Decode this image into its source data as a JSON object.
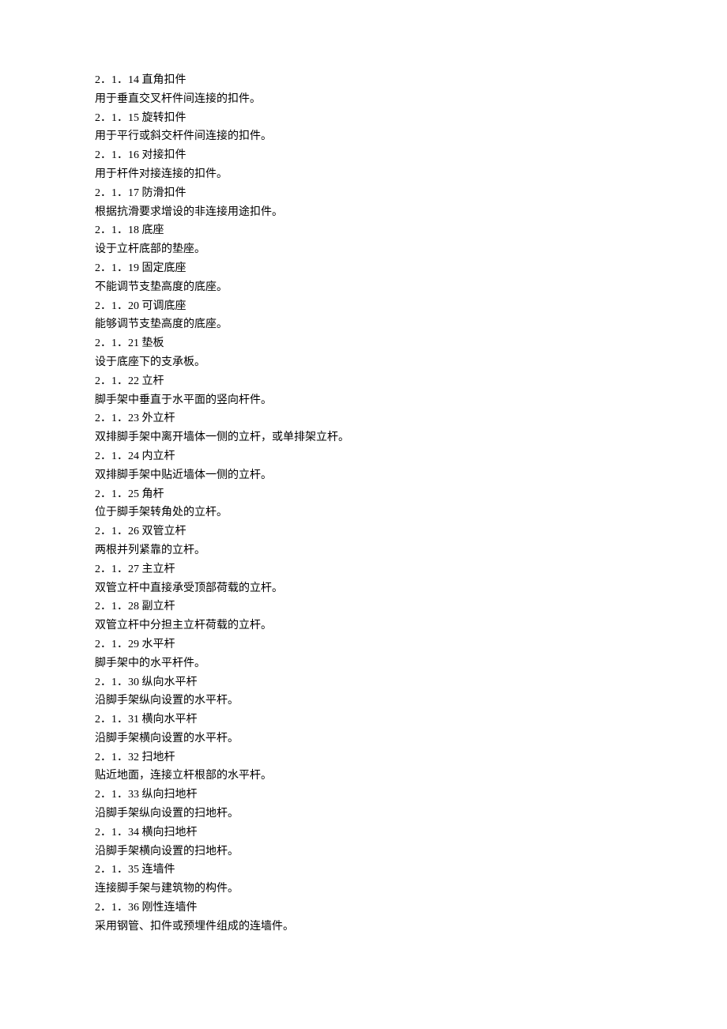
{
  "entries": [
    {
      "num": "2．1．14",
      "term": "直角扣件",
      "def": "用于垂直交叉杆件间连接的扣件。"
    },
    {
      "num": "2．1．15",
      "term": "旋转扣件",
      "def": "用于平行或斜交杆件间连接的扣件。"
    },
    {
      "num": "2．1．16",
      "term": "对接扣件",
      "def": "用于杆件对接连接的扣件。"
    },
    {
      "num": "2．1．17",
      "term": "防滑扣件",
      "def": "根据抗滑要求增设的非连接用途扣件。"
    },
    {
      "num": "2．1．18",
      "term": "底座",
      "def": "设于立杆底部的垫座。"
    },
    {
      "num": "2．1．19",
      "term": "固定底座",
      "def": "不能调节支垫高度的底座。"
    },
    {
      "num": "2．1．20",
      "term": "可调底座",
      "def": "能够调节支垫高度的底座。"
    },
    {
      "num": "2．1．21",
      "term": "垫板",
      "def": "设于底座下的支承板。"
    },
    {
      "num": "2．1．22",
      "term": "立杆",
      "def": "脚手架中垂直于水平面的竖向杆件。"
    },
    {
      "num": "2．1．23",
      "term": "外立杆",
      "def": "双排脚手架中离开墙体一侧的立杆，或单排架立杆。"
    },
    {
      "num": "2．1．24",
      "term": "内立杆",
      "def": "双排脚手架中贴近墙体一侧的立杆。"
    },
    {
      "num": "2．1．25",
      "term": "角杆",
      "def": "位于脚手架转角处的立杆。"
    },
    {
      "num": "2．1．26",
      "term": "双管立杆",
      "def": "两根并列紧靠的立杆。"
    },
    {
      "num": "2．1．27",
      "term": "主立杆",
      "def": "双管立杆中直接承受顶部荷载的立杆。"
    },
    {
      "num": "2．1．28",
      "term": "副立杆",
      "def": "双管立杆中分担主立杆荷载的立杆。"
    },
    {
      "num": "2．1．29",
      "term": "水平杆",
      "def": "脚手架中的水平杆件。"
    },
    {
      "num": "2．1．30",
      "term": "纵向水平杆",
      "def": "沿脚手架纵向设置的水平杆。"
    },
    {
      "num": "2．1．31",
      "term": "横向水平杆",
      "def": "沿脚手架横向设置的水平杆。"
    },
    {
      "num": "2．1．32",
      "term": "扫地杆",
      "def": "贴近地面，连接立杆根部的水平杆。"
    },
    {
      "num": "2．1．33",
      "term": "纵向扫地杆",
      "def": "沿脚手架纵向设置的扫地杆。"
    },
    {
      "num": "2．1．34",
      "term": "横向扫地杆",
      "def": "沿脚手架横向设置的扫地杆。"
    },
    {
      "num": "2．1．35",
      "term": "连墙件",
      "def": "连接脚手架与建筑物的构件。"
    },
    {
      "num": "2．1．36",
      "term": "刚性连墙件",
      "def": "采用钢管、扣件或预埋件组成的连墙件。"
    }
  ]
}
